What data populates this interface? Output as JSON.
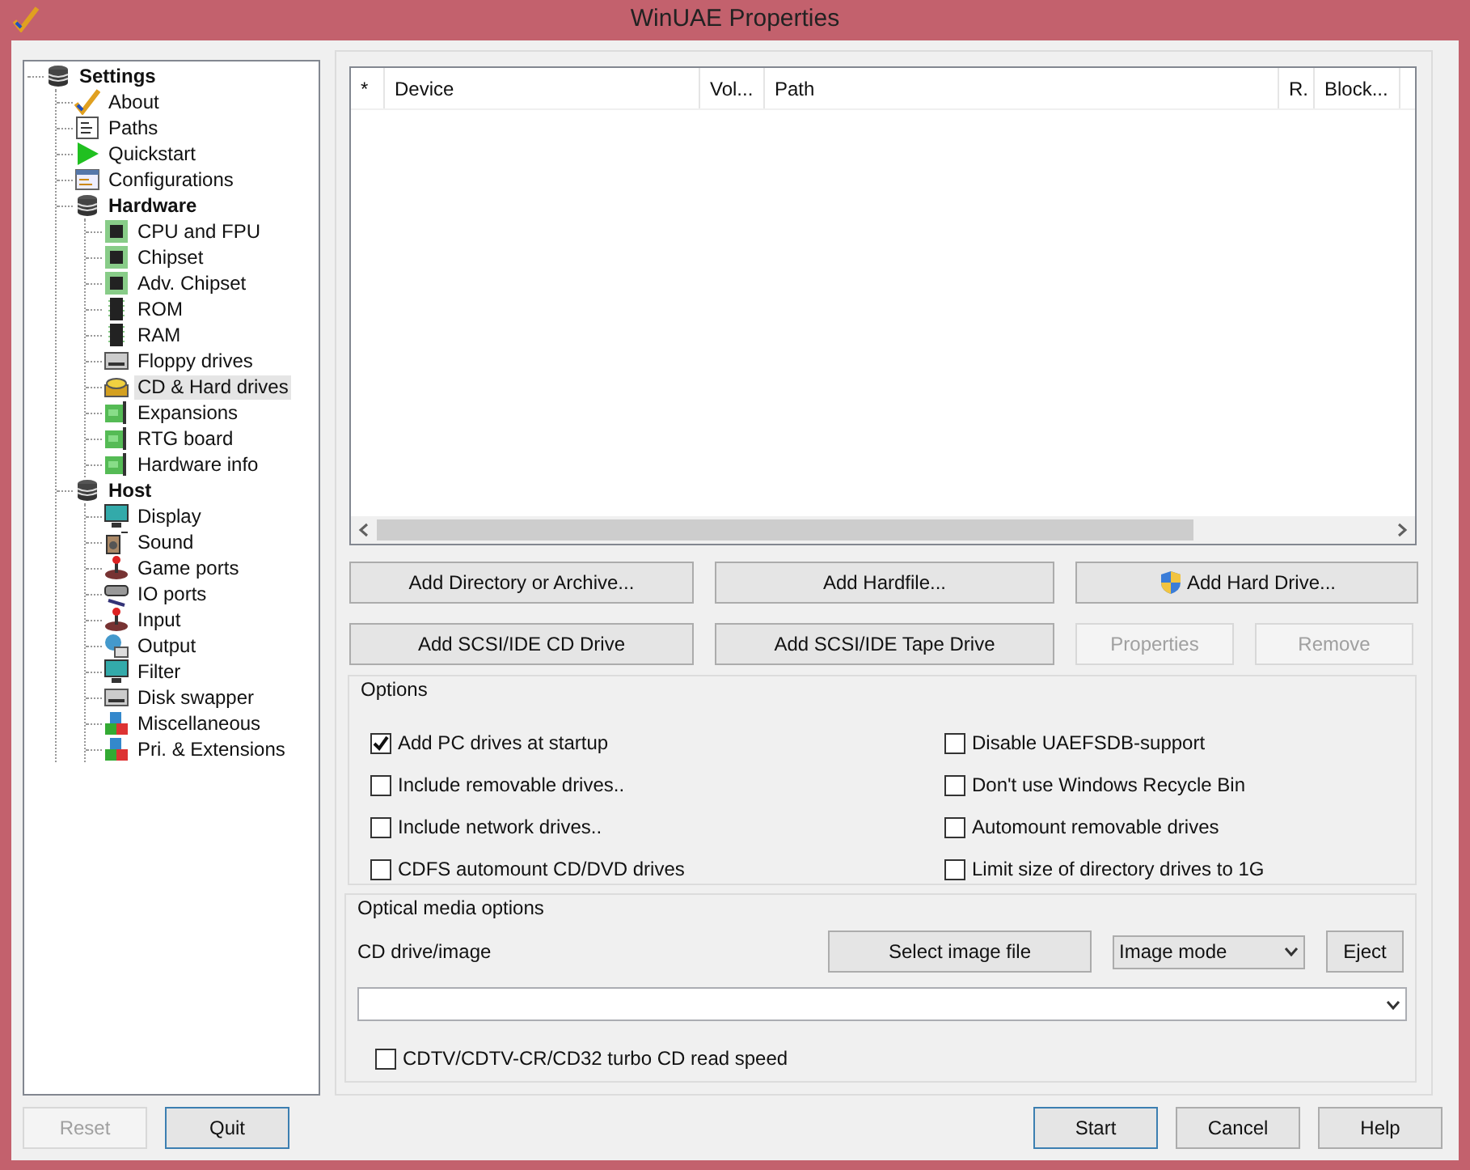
{
  "window": {
    "title": "WinUAE Properties"
  },
  "tree": [
    {
      "label": "Settings",
      "selected": false,
      "children": [
        {
          "label": "About",
          "selected": false
        },
        {
          "label": "Paths",
          "selected": false
        },
        {
          "label": "Quickstart",
          "selected": false
        },
        {
          "label": "Configurations",
          "selected": false
        },
        {
          "label": "Hardware",
          "selected": false,
          "children": [
            {
              "label": "CPU and FPU",
              "selected": false
            },
            {
              "label": "Chipset",
              "selected": false
            },
            {
              "label": "Adv. Chipset",
              "selected": false
            },
            {
              "label": "ROM",
              "selected": false
            },
            {
              "label": "RAM",
              "selected": false
            },
            {
              "label": "Floppy drives",
              "selected": false
            },
            {
              "label": "CD & Hard drives",
              "selected": true
            },
            {
              "label": "Expansions",
              "selected": false
            },
            {
              "label": "RTG board",
              "selected": false
            },
            {
              "label": "Hardware info",
              "selected": false
            }
          ]
        },
        {
          "label": "Host",
          "selected": false,
          "children": [
            {
              "label": "Display",
              "selected": false
            },
            {
              "label": "Sound",
              "selected": false
            },
            {
              "label": "Game ports",
              "selected": false
            },
            {
              "label": "IO ports",
              "selected": false
            },
            {
              "label": "Input",
              "selected": false
            },
            {
              "label": "Output",
              "selected": false
            },
            {
              "label": "Filter",
              "selected": false
            },
            {
              "label": "Disk swapper",
              "selected": false
            },
            {
              "label": "Miscellaneous",
              "selected": false
            },
            {
              "label": "Pri. & Extensions",
              "selected": false
            }
          ]
        }
      ]
    }
  ],
  "drives_table": {
    "columns": [
      "*",
      "Device",
      "Vol...",
      "Path",
      "R.",
      "Block..."
    ]
  },
  "button_rows": [
    [
      {
        "label": "Add Directory or Archive...",
        "disabled": false,
        "kind": "plain"
      },
      {
        "label": "Add Hardfile...",
        "disabled": false,
        "kind": "plain"
      },
      {
        "label": "Add Hard Drive...",
        "disabled": false,
        "kind": "shield"
      }
    ],
    [
      {
        "label": "Add SCSI/IDE CD Drive",
        "disabled": false,
        "kind": "plain"
      },
      {
        "label": "Add SCSI/IDE Tape Drive",
        "disabled": false,
        "kind": "plain"
      },
      {
        "label": "Properties",
        "disabled": true,
        "kind": "plain"
      },
      {
        "label": "Remove",
        "disabled": true,
        "kind": "plain"
      }
    ]
  ],
  "options": {
    "title": "Options",
    "left": [
      {
        "label": "Add PC drives at startup",
        "checked": true
      },
      {
        "label": "Include removable drives..",
        "checked": false
      },
      {
        "label": "Include network drives..",
        "checked": false
      },
      {
        "label": "CDFS automount CD/DVD drives",
        "checked": false
      }
    ],
    "right": [
      {
        "label": "Disable UAEFSDB-support",
        "checked": false
      },
      {
        "label": "Don't use Windows Recycle Bin",
        "checked": false
      },
      {
        "label": "Automount removable drives",
        "checked": false
      },
      {
        "label": "Limit size of directory drives to 1G",
        "checked": false
      }
    ]
  },
  "optical": {
    "title": "Optical media options",
    "label": "CD drive/image",
    "select_button": "Select image file",
    "mode": "Image mode",
    "eject_button": "Eject",
    "turbo": {
      "label": "CDTV/CDTV-CR/CD32 turbo CD read speed",
      "checked": false
    }
  },
  "footer": {
    "left": [
      {
        "label": "Reset",
        "disabled": true,
        "focused": false
      },
      {
        "label": "Quit",
        "disabled": false,
        "focused": true
      }
    ],
    "right": [
      {
        "label": "Start",
        "disabled": false,
        "focused": true
      },
      {
        "label": "Cancel",
        "disabled": false,
        "focused": false
      },
      {
        "label": "Help",
        "disabled": false,
        "focused": false
      }
    ]
  }
}
